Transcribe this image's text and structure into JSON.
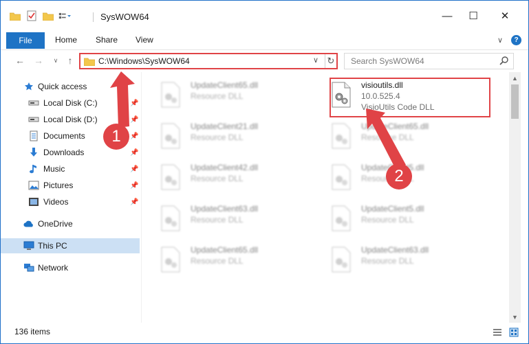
{
  "window": {
    "title": "SysWOW64",
    "minimize_glyph": "—",
    "maximize_glyph": "☐",
    "close_glyph": "✕"
  },
  "ribbon": {
    "tabs": [
      "File",
      "Home",
      "Share",
      "View"
    ],
    "expand_glyph": "∨",
    "help_glyph": "?"
  },
  "address": {
    "path": "C:\\Windows\\SysWOW64",
    "dropdown_glyph": "∨",
    "refresh_glyph": "↻"
  },
  "search": {
    "placeholder": "Search SysWOW64"
  },
  "nav": {
    "back_glyph": "←",
    "forward_glyph": "→",
    "recent_glyph": "∨",
    "up_glyph": "↑",
    "items": [
      {
        "label": "Quick access",
        "icon": "star-icon"
      },
      {
        "label": "Local Disk (C:)",
        "icon": "drive-icon"
      },
      {
        "label": "Local Disk (D:)",
        "icon": "drive-icon"
      },
      {
        "label": "Documents",
        "icon": "documents-icon"
      },
      {
        "label": "Downloads",
        "icon": "download-icon"
      },
      {
        "label": "Music",
        "icon": "music-icon"
      },
      {
        "label": "Pictures",
        "icon": "pictures-icon"
      },
      {
        "label": "Videos",
        "icon": "videos-icon"
      },
      {
        "label": "OneDrive",
        "icon": "cloud-icon"
      },
      {
        "label": "This PC",
        "icon": "computer-icon"
      },
      {
        "label": "Network",
        "icon": "network-icon"
      }
    ]
  },
  "files": {
    "left": [
      {
        "name": "UpdateClient65.dll",
        "type": "Resource DLL"
      },
      {
        "name": "UpdateClient21.dll",
        "type": "Resource DLL"
      },
      {
        "name": "UpdateClient42.dll",
        "type": "Resource DLL"
      },
      {
        "name": "UpdateClient63.dll",
        "type": "Resource DLL"
      },
      {
        "name": "UpdateClient65.dll",
        "type": "Resource DLL"
      }
    ],
    "right": [
      {
        "name": "UpdateClient65.dll",
        "type": "Resource DLL"
      },
      {
        "name": "UpdateClient5.dll",
        "type": "Resource DLL"
      },
      {
        "name": "UpdateClient5.dll",
        "type": "Resource DLL"
      },
      {
        "name": "UpdateClient63.dll",
        "type": "Resource DLL"
      }
    ],
    "featured": {
      "name": "visioutils.dll",
      "version": "10.0.525.4",
      "description": "VisioUtils Code DLL"
    }
  },
  "status": {
    "item_count": "136 items"
  },
  "annotations": {
    "badge_1": "1",
    "badge_2": "2",
    "color": "#e04346"
  },
  "colors": {
    "accent": "#1e73c5",
    "selected": "#cce0f4",
    "highlight": "#e04346"
  }
}
